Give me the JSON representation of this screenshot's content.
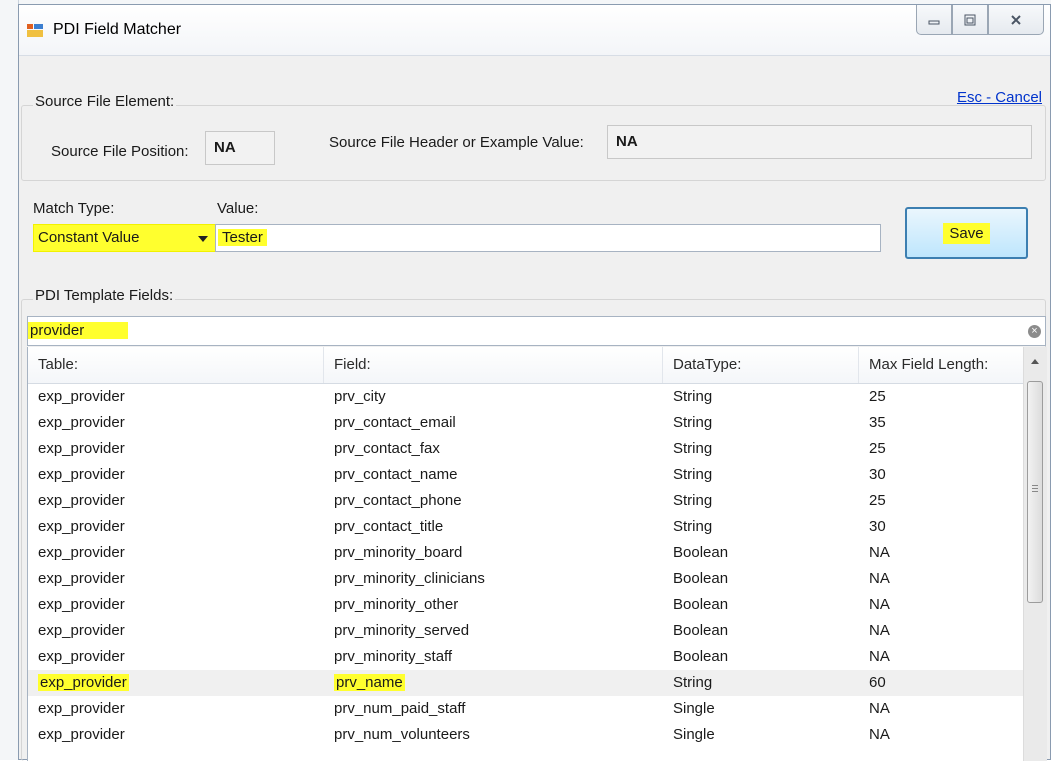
{
  "window": {
    "title": "PDI Field Matcher"
  },
  "esc_cancel": "Esc - Cancel",
  "source": {
    "group_label": "Source File Element:",
    "position_label": "Source File Position:",
    "position_value": "NA",
    "header_label": "Source File Header or Example Value:",
    "header_value": "NA"
  },
  "match": {
    "type_label": "Match Type:",
    "type_value": "Constant Value",
    "value_label": "Value:",
    "value_text": "Tester",
    "save_label": "Save"
  },
  "template": {
    "group_label": "PDI Template Fields:",
    "search_value": "provider",
    "columns": [
      "Table:",
      "Field:",
      "DataType:",
      "Max Field Length:"
    ],
    "rows": [
      [
        "exp_provider",
        "prv_city",
        "String",
        "25"
      ],
      [
        "exp_provider",
        "prv_contact_email",
        "String",
        "35"
      ],
      [
        "exp_provider",
        "prv_contact_fax",
        "String",
        "25"
      ],
      [
        "exp_provider",
        "prv_contact_name",
        "String",
        "30"
      ],
      [
        "exp_provider",
        "prv_contact_phone",
        "String",
        "25"
      ],
      [
        "exp_provider",
        "prv_contact_title",
        "String",
        "30"
      ],
      [
        "exp_provider",
        "prv_minority_board",
        "Boolean",
        "NA"
      ],
      [
        "exp_provider",
        "prv_minority_clinicians",
        "Boolean",
        "NA"
      ],
      [
        "exp_provider",
        "prv_minority_other",
        "Boolean",
        "NA"
      ],
      [
        "exp_provider",
        "prv_minority_served",
        "Boolean",
        "NA"
      ],
      [
        "exp_provider",
        "prv_minority_staff",
        "Boolean",
        "NA"
      ],
      [
        "exp_provider",
        "prv_name",
        "String",
        "60"
      ],
      [
        "exp_provider",
        "prv_num_paid_staff",
        "Single",
        "NA"
      ],
      [
        "exp_provider",
        "prv_num_volunteers",
        "Single",
        "NA"
      ]
    ],
    "selected_row": 11
  },
  "colors": {
    "highlight": "#ffff2e",
    "link": "#0033cc",
    "save_border": "#3c7fb1"
  }
}
